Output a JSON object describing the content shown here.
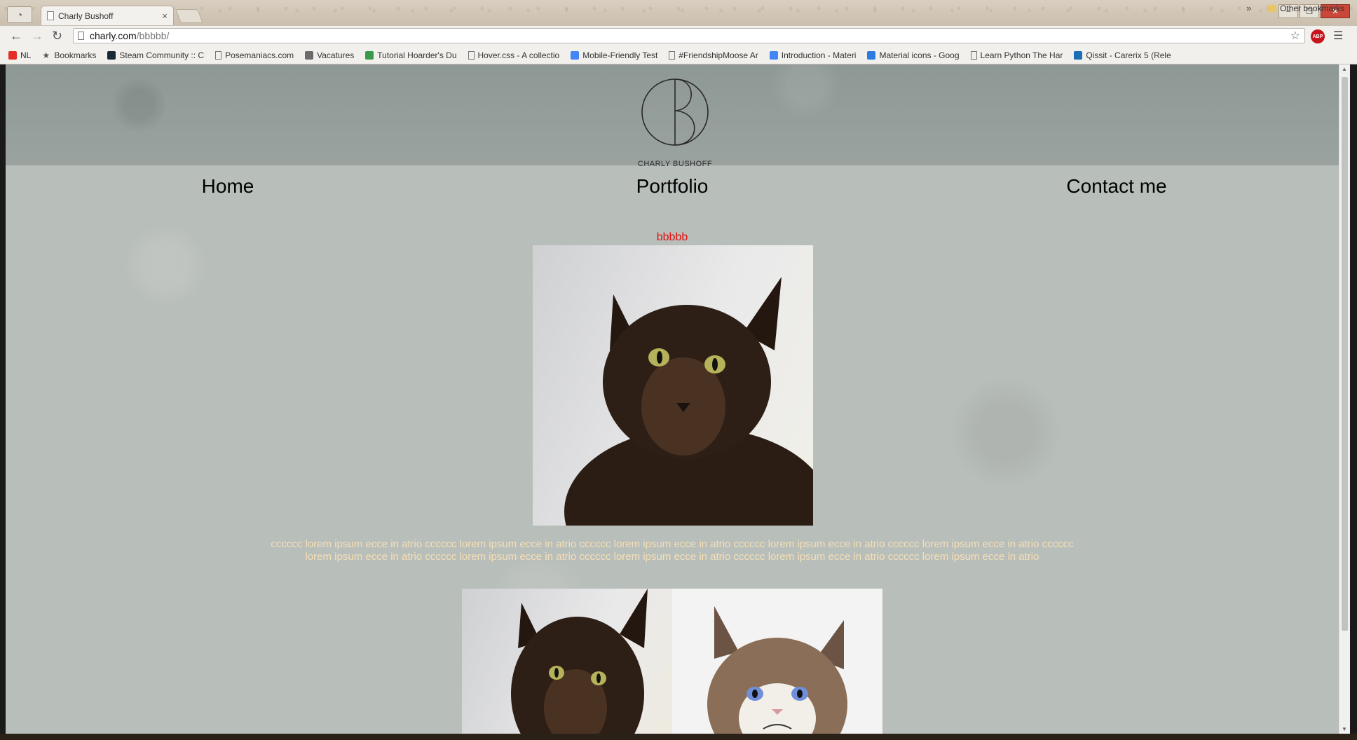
{
  "browser": {
    "tab_title": "Charly Bushoff",
    "tab_close": "×",
    "url_host": "charly.com",
    "url_path": "/bbbbb/",
    "window_controls": {
      "minimize": "–",
      "restore": "❐",
      "close": "✕"
    },
    "extension_badge": "ABP",
    "bookmarks": [
      {
        "label": "NL",
        "icon": "youtube-icon",
        "color": "#e52d27"
      },
      {
        "label": "Bookmarks",
        "icon": "star-icon",
        "color": "#555555"
      },
      {
        "label": "Steam Community :: C",
        "icon": "steam-icon",
        "color": "#1b2838"
      },
      {
        "label": "Posemaniacs.com",
        "icon": "page-icon",
        "color": "#777777"
      },
      {
        "label": "Vacatures",
        "icon": "stack-icon",
        "color": "#6b6b6b"
      },
      {
        "label": "Tutorial Hoarder's Du",
        "icon": "circle-icon",
        "color": "#3a9a4a"
      },
      {
        "label": "Hover.css - A collectio",
        "icon": "page-icon",
        "color": "#777777"
      },
      {
        "label": "Mobile-Friendly Test",
        "icon": "google-icon",
        "color": "#4285f4"
      },
      {
        "label": "#FriendshipMoose Ar",
        "icon": "page-icon",
        "color": "#777777"
      },
      {
        "label": "Introduction - Materi",
        "icon": "google-icon",
        "color": "#4285f4"
      },
      {
        "label": "Material icons - Goog",
        "icon": "material-icon",
        "color": "#2d7be0"
      },
      {
        "label": "Learn Python The Har",
        "icon": "page-icon",
        "color": "#777777"
      },
      {
        "label": "Qissit - Carerix 5 (Rele",
        "icon": "qissit-icon",
        "color": "#1a6fb5"
      }
    ],
    "bookmarks_overflow": "»",
    "other_bookmarks": "Other bookmarks"
  },
  "page": {
    "logo_name": "CHARLY BUSHOFF",
    "nav": [
      {
        "label": "Home"
      },
      {
        "label": "Portfolio"
      },
      {
        "label": "Contact me"
      }
    ],
    "post_title": "bbbbb",
    "post_body": "cccccc lorem ipsum ecce in atrio cccccc lorem ipsum ecce in atrio cccccc lorem ipsum ecce in atrio cccccc lorem ipsum ecce in atrio cccccc lorem ipsum ecce in atrio cccccc lorem ipsum ecce in atrio cccccc lorem ipsum ecce in atrio cccccc lorem ipsum ecce in atrio cccccc lorem ipsum ecce in atrio cccccc lorem ipsum ecce in atrio",
    "images": [
      "brown-cat-photo",
      "brown-cat-photo",
      "grumpy-cat-photo"
    ]
  },
  "colors": {
    "post_title": "#e01010",
    "post_body": "#f6dfb5",
    "nav_text": "#000000"
  }
}
